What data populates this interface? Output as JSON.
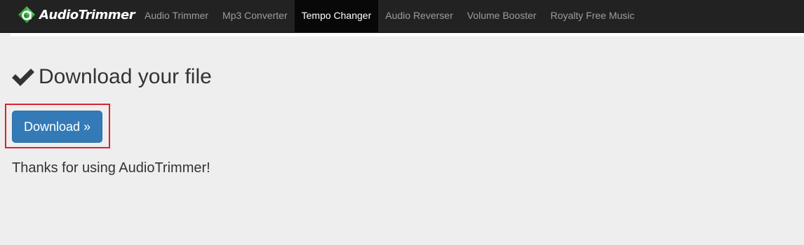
{
  "brand": {
    "name": "AudioTrimmer",
    "logo_icon": "audiotrimmer-logo-icon"
  },
  "nav": {
    "items": [
      {
        "label": "Audio Trimmer",
        "active": false
      },
      {
        "label": "Mp3 Converter",
        "active": false
      },
      {
        "label": "Tempo Changer",
        "active": true
      },
      {
        "label": "Audio Reverser",
        "active": false
      },
      {
        "label": "Volume Booster",
        "active": false
      },
      {
        "label": "Royalty Free Music",
        "active": false
      }
    ]
  },
  "main": {
    "heading": "Download your file",
    "heading_icon": "checkmark-icon",
    "download_button": "Download »",
    "thanks_text": "Thanks for using AudioTrimmer!"
  },
  "colors": {
    "navbar_bg": "#222222",
    "active_nav_bg": "#080808",
    "nav_text": "#9d9d9d",
    "page_bg": "#eeeeee",
    "button_bg": "#337ab7",
    "highlight_border": "#d9232d",
    "logo_green": "#3aa845"
  }
}
